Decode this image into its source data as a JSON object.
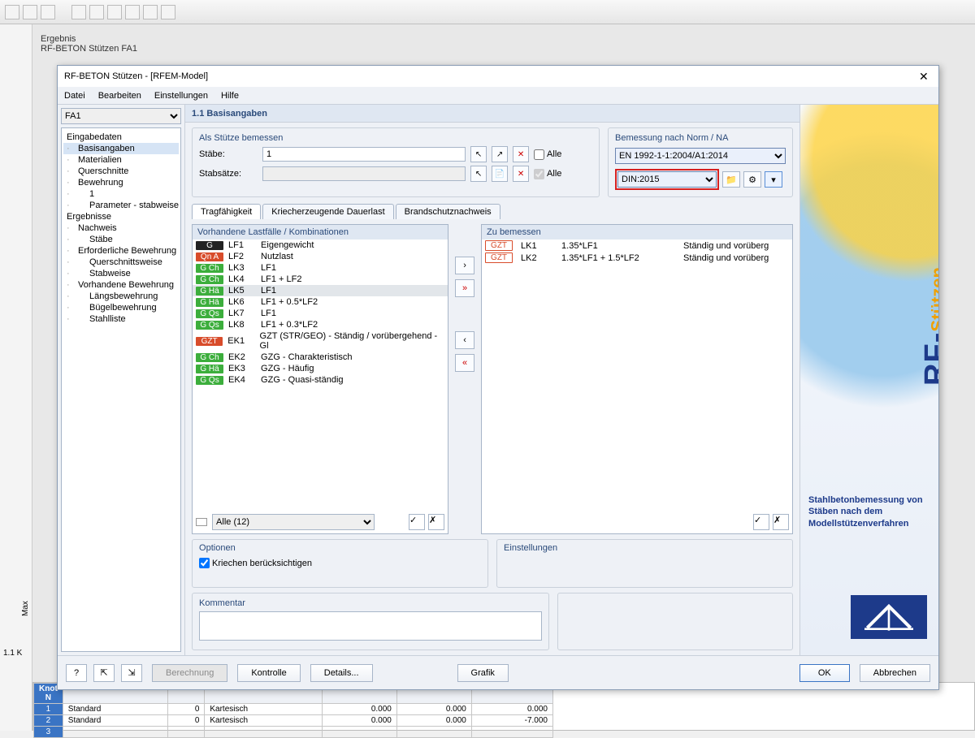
{
  "hint": {
    "line1": "Ergebnis",
    "line2": "RF-BETON Stützen FA1"
  },
  "dialog": {
    "title": "RF-BETON Stützen - [RFEM-Model]",
    "menu": [
      "Datei",
      "Bearbeiten",
      "Einstellungen",
      "Hilfe"
    ],
    "case_selector": "FA1",
    "page_header": "1.1 Basisangaben",
    "tree": {
      "roots": [
        {
          "label": "Eingabedaten",
          "children": [
            {
              "label": "Basisangaben",
              "selected": true
            },
            {
              "label": "Materialien"
            },
            {
              "label": "Querschnitte"
            },
            {
              "label": "Bewehrung",
              "children": [
                {
                  "label": "1"
                },
                {
                  "label": "Parameter - stabweise"
                }
              ]
            }
          ]
        },
        {
          "label": "Ergebnisse",
          "children": [
            {
              "label": "Nachweis",
              "children": [
                {
                  "label": "Stäbe"
                }
              ]
            },
            {
              "label": "Erforderliche Bewehrung",
              "children": [
                {
                  "label": "Querschnittsweise"
                },
                {
                  "label": "Stabweise"
                }
              ]
            },
            {
              "label": "Vorhandene Bewehrung",
              "children": [
                {
                  "label": "Längsbewehrung"
                },
                {
                  "label": "Bügelbewehrung"
                },
                {
                  "label": "Stahlliste"
                }
              ]
            }
          ]
        }
      ]
    },
    "support_group": {
      "legend": "Als Stütze bemessen",
      "staebe_label": "Stäbe:",
      "staebe_value": "1",
      "stabsaetze_label": "Stabsätze:",
      "alle_label": "Alle"
    },
    "norm_group": {
      "legend": "Bemessung nach Norm / NA",
      "norm_value": "EN 1992-1-1:2004/A1:2014",
      "na_value": "DIN:2015"
    },
    "tabs": [
      "Tragfähigkeit",
      "Kriecherzeugende Dauerlast",
      "Brandschutznachweis"
    ],
    "loadcases": {
      "header": "Vorhandene Lastfälle / Kombinationen",
      "items": [
        {
          "tag": "G",
          "tagClass": "GBlack",
          "code": "LF1",
          "text": "Eigengewicht"
        },
        {
          "tag": "Qn A",
          "tagClass": "QnA",
          "code": "LF2",
          "text": "Nutzlast"
        },
        {
          "tag": "G Ch",
          "tagClass": "GCh",
          "code": "LK3",
          "text": "LF1"
        },
        {
          "tag": "G Ch",
          "tagClass": "GCh",
          "code": "LK4",
          "text": "LF1 + LF2"
        },
        {
          "tag": "G Hä",
          "tagClass": "GHa",
          "code": "LK5",
          "text": "LF1",
          "sel": true
        },
        {
          "tag": "G Hä",
          "tagClass": "GHa",
          "code": "LK6",
          "text": "LF1 + 0.5*LF2"
        },
        {
          "tag": "G Qs",
          "tagClass": "GQs",
          "code": "LK7",
          "text": "LF1"
        },
        {
          "tag": "G Qs",
          "tagClass": "GQs",
          "code": "LK8",
          "text": "LF1 + 0.3*LF2"
        },
        {
          "tag": "GZT",
          "tagClass": "GZT",
          "code": "EK1",
          "text": "GZT (STR/GEO) - Ständig / vorübergehend - Gl"
        },
        {
          "tag": "G Ch",
          "tagClass": "GCh",
          "code": "EK2",
          "text": "GZG - Charakteristisch"
        },
        {
          "tag": "G Hä",
          "tagClass": "GHa",
          "code": "EK3",
          "text": "GZG - Häufig"
        },
        {
          "tag": "G Qs",
          "tagClass": "GQs",
          "code": "EK4",
          "text": "GZG - Quasi-ständig"
        }
      ],
      "filter": "Alle (12)"
    },
    "design": {
      "header": "Zu bemessen",
      "items": [
        {
          "tag": "GZT",
          "tagClass": "GZTr",
          "code": "LK1",
          "factor": "1.35*LF1",
          "desc": "Ständig und vorüberg"
        },
        {
          "tag": "GZT",
          "tagClass": "GZTr",
          "code": "LK2",
          "factor": "1.35*LF1 + 1.5*LF2",
          "desc": "Ständig und vorüberg"
        }
      ]
    },
    "options": {
      "legend": "Optionen",
      "creep": "Kriechen berücksichtigen"
    },
    "settings": {
      "legend": "Einstellungen"
    },
    "comment": {
      "legend": "Kommentar"
    },
    "product": {
      "name": "RF-BETON",
      "sub": "Stützen",
      "desc": "Stahlbetonbemessung von Stäben nach dem Modellstützenverfahren"
    },
    "footer": {
      "calc": "Berechnung",
      "check": "Kontrolle",
      "details": "Details...",
      "grafik": "Grafik",
      "ok": "OK",
      "cancel": "Abbrechen"
    }
  },
  "bg_table": {
    "head": [
      "Knot",
      "",
      "",
      "",
      "",
      "",
      ""
    ],
    "rows": [
      {
        "n": "1",
        "a": "Standard",
        "b": "0",
        "c": "Kartesisch",
        "d": "0.000",
        "e": "0.000",
        "f": "0.000"
      },
      {
        "n": "2",
        "a": "Standard",
        "b": "0",
        "c": "Kartesisch",
        "d": "0.000",
        "e": "0.000",
        "f": "-7.000"
      },
      {
        "n": "3",
        "a": "",
        "b": "",
        "c": "",
        "d": "",
        "e": "",
        "f": ""
      }
    ]
  },
  "left_stub": {
    "t1": "Max",
    "t2": "1.1 K"
  }
}
